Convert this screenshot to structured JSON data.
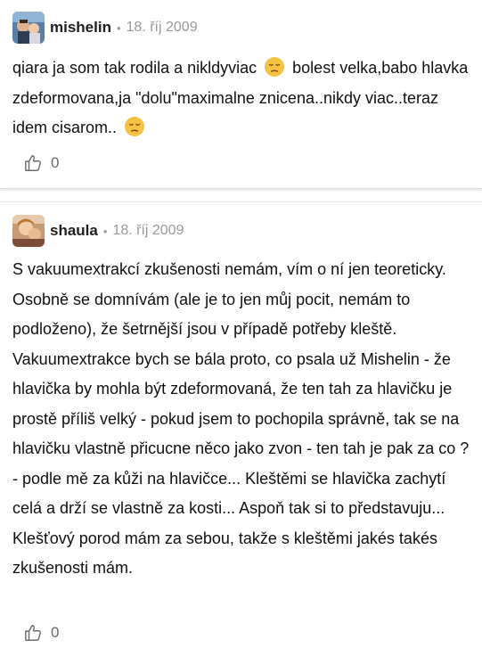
{
  "posts": [
    {
      "username": "mishelin",
      "separator": "•",
      "date": "18. říj 2009",
      "text_part1": "qiara ja som tak rodila a nikldyviac",
      "text_part2": "bolest velka,babo hlavka zdeformovana,ja \"dolu\"maximalne znicena..nikdy viac..teraz idem cisarom..",
      "emoji": "pensive-face-icon",
      "likes": "0"
    },
    {
      "username": "shaula",
      "separator": "•",
      "date": "18. říj 2009",
      "text": "S vakuumextrakcí zkušenosti nemám, vím o ní jen teoreticky. Osobně se domnívám (ale je to jen můj pocit, nemám to podloženo), že šetrnější jsou v případě potřeby kleště. Vakuumextrakce bych se bála proto, co psala už Mishelin - že hlavička by mohla být zdeformovaná, že ten tah za hlavičku je prostě příliš velký - pokud jsem to pochopila správně, tak se na hlavičku vlastně přicucne něco jako zvon - ten tah je pak za co ? - podle mě za kůži na hlavičce... Kleštěmi se hlavička zachytí celá a drží se vlastně za kosti... Aspoň tak si to představuju... Klešťový porod mám za sebou, takže s kleštěmi jakés takés zkušenosti mám.",
      "likes": "0"
    }
  ],
  "icons": {
    "like": "thumbs-up-icon",
    "emoji": "pensive-face-icon"
  },
  "colors": {
    "meta_gray": "#9a9a9a",
    "text": "#111111",
    "emoji_yellow": "#f6c244"
  }
}
